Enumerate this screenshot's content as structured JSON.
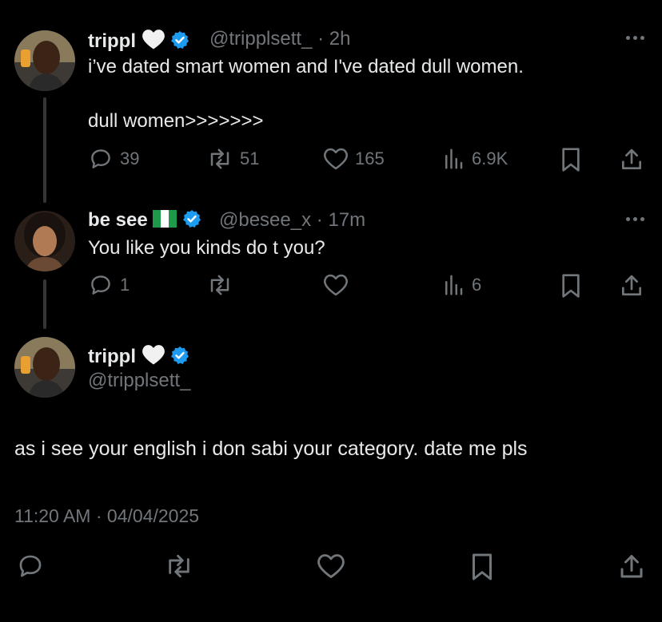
{
  "tweet1": {
    "name": "trippl",
    "handle": "@tripplsett_",
    "time": "2h",
    "line1": "i’ve dated smart women and I've dated dull women.",
    "line2": "dull women>>>>>>>",
    "replies": "39",
    "reposts": "51",
    "likes": "165",
    "views": "6.9K"
  },
  "tweet2": {
    "name": "be see",
    "handle": "@besee_x",
    "time": "17m",
    "text": "You like you kinds do t you?",
    "replies": "1",
    "views": "6"
  },
  "tweet3": {
    "name": "trippl",
    "handle": "@tripplsett_",
    "text": "as i see your english i don sabi your category. date me pls",
    "timestamp": "11:20 AM · 04/04/2025"
  },
  "colors": {
    "background": "#000000",
    "text": "#e7e9ea",
    "muted": "#71767b",
    "verified": "#1d9bf0",
    "thread_line": "#333639"
  }
}
